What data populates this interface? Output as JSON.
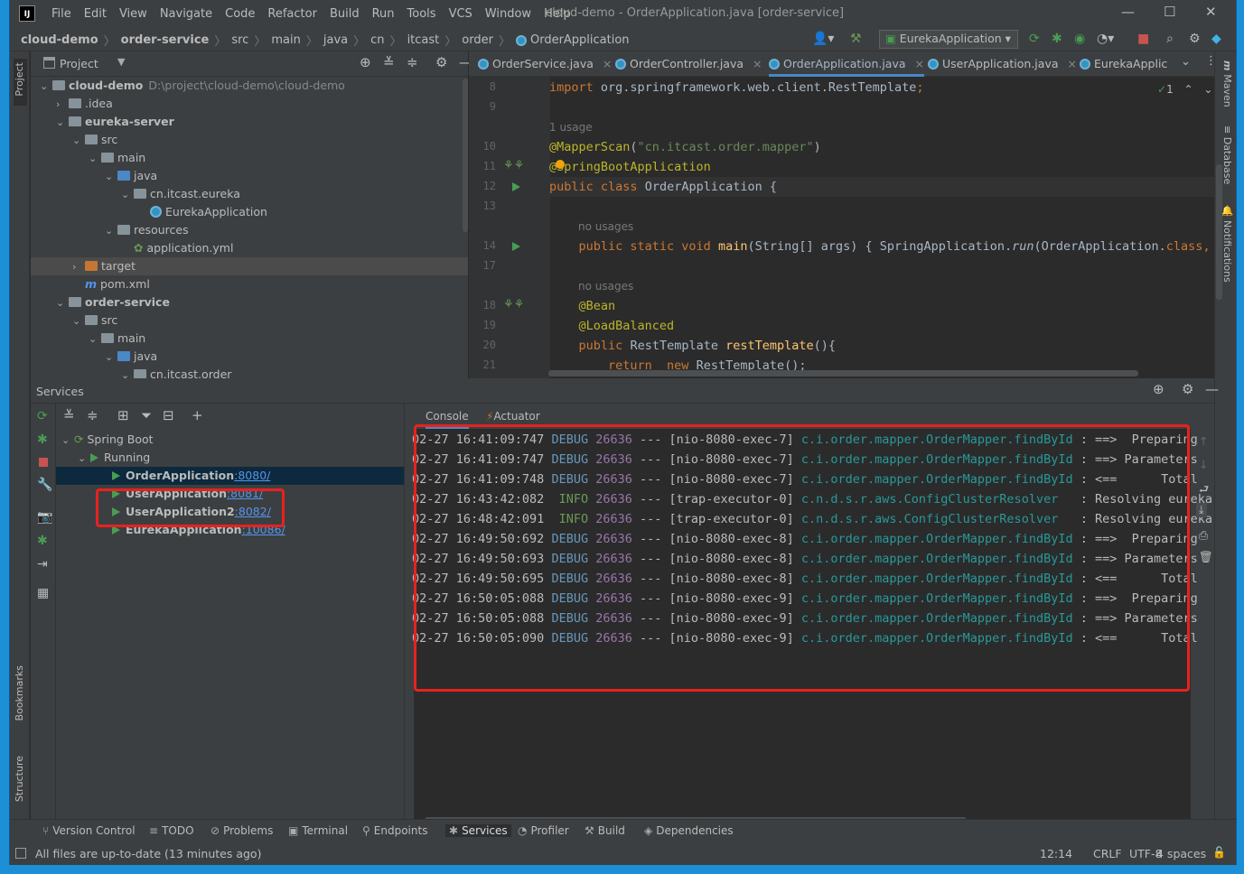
{
  "window": {
    "title": "cloud-demo - OrderApplication.java [order-service]",
    "logo": "IJ"
  },
  "menu": [
    "File",
    "Edit",
    "View",
    "Navigate",
    "Code",
    "Refactor",
    "Build",
    "Run",
    "Tools",
    "VCS",
    "Window",
    "Help"
  ],
  "breadcrumbs": [
    "cloud-demo",
    "order-service",
    "src",
    "main",
    "java",
    "cn",
    "itcast",
    "order",
    "OrderApplication"
  ],
  "run_config": "EurekaApplication",
  "project": {
    "title": "Project",
    "tree": [
      {
        "label": "cloud-demo",
        "path": "D:\\project\\cloud-demo\\cloud-demo",
        "depth": 0,
        "expanded": true,
        "kind": "module",
        "bold": true
      },
      {
        "label": ".idea",
        "depth": 1,
        "expanded": false,
        "kind": "folder"
      },
      {
        "label": "eureka-server",
        "depth": 1,
        "expanded": true,
        "kind": "module",
        "bold": true
      },
      {
        "label": "src",
        "depth": 2,
        "expanded": true,
        "kind": "folder"
      },
      {
        "label": "main",
        "depth": 3,
        "expanded": true,
        "kind": "folder"
      },
      {
        "label": "java",
        "depth": 4,
        "expanded": true,
        "kind": "blue"
      },
      {
        "label": "cn.itcast.eureka",
        "depth": 5,
        "expanded": true,
        "kind": "folder"
      },
      {
        "label": "EurekaApplication",
        "depth": 6,
        "kind": "class"
      },
      {
        "label": "resources",
        "depth": 4,
        "expanded": true,
        "kind": "folder"
      },
      {
        "label": "application.yml",
        "depth": 5,
        "kind": "yml"
      },
      {
        "label": "target",
        "depth": 2,
        "expanded": false,
        "kind": "orange",
        "selected": true
      },
      {
        "label": "pom.xml",
        "depth": 2,
        "kind": "pom"
      },
      {
        "label": "order-service",
        "depth": 1,
        "expanded": true,
        "kind": "module",
        "bold": true
      },
      {
        "label": "src",
        "depth": 2,
        "expanded": true,
        "kind": "folder"
      },
      {
        "label": "main",
        "depth": 3,
        "expanded": true,
        "kind": "folder"
      },
      {
        "label": "java",
        "depth": 4,
        "expanded": true,
        "kind": "blue"
      },
      {
        "label": "cn.itcast.order",
        "depth": 5,
        "expanded": true,
        "kind": "folder"
      }
    ]
  },
  "editor": {
    "tabs": [
      "OrderService.java",
      "OrderController.java",
      "OrderApplication.java",
      "UserApplication.java",
      "EurekaApplic"
    ],
    "active_tab": 2,
    "inspection": "1",
    "lines": [
      {
        "n": "8",
        "html": "<span style='color:#cc7832'>import</span> <span style='color:#a9b7c6'>org.springframework.web.client.RestTemplate</span><span style='color:#cc7832'>;</span>"
      },
      {
        "n": "9",
        "html": ""
      },
      {
        "n": "",
        "hint": "1 usage"
      },
      {
        "n": "10",
        "html": "<span style='color:#bbb529'>@MapperScan</span><span style='color:#a9b7c6'>(</span><span style='color:#6a8759'>\"cn.itcast.order.mapper\"</span><span style='color:#a9b7c6'>)</span>"
      },
      {
        "n": "11",
        "html": "<span style='color:#bbb529'>@SpringBootApplication</span>"
      },
      {
        "n": "12",
        "html": "<span style='color:#cc7832'>public class</span> <span style='color:#a9b7c6'>OrderApplication {</span>"
      },
      {
        "n": "13",
        "html": ""
      },
      {
        "n": "",
        "hint": "no usages"
      },
      {
        "n": "14",
        "html": "    <span style='color:#cc7832'>public static void</span> <span style='color:#ffc66d'>main</span><span style='color:#a9b7c6'>(String[] args) { SpringApplication.</span><span style='color:#a9b7c6;font-style:italic'>run</span><span style='color:#a9b7c6'>(OrderApplication.</span><span style='color:#cc7832'>class</span><span style='color:#cc7832'>, </span><span style='color:#a9b7c6'>args)</span>"
      },
      {
        "n": "17",
        "html": ""
      },
      {
        "n": "",
        "hint": "no usages"
      },
      {
        "n": "18",
        "html": "    <span style='color:#bbb529'>@Bean</span>"
      },
      {
        "n": "19",
        "html": "    <span style='color:#bbb529'>@LoadBalanced</span>"
      },
      {
        "n": "20",
        "html": "    <span style='color:#cc7832'>public</span> <span style='color:#a9b7c6'>RestTemplate</span> <span style='color:#ffc66d'>restTemplate</span><span style='color:#a9b7c6'>(){</span>"
      },
      {
        "n": "21",
        "html": "        <span style='color:#cc7832'>return  new</span> <span style='color:#a9b7c6'>RestTemplate();</span>"
      }
    ]
  },
  "services": {
    "title": "Services",
    "tree": [
      {
        "label": "Spring Boot",
        "depth": 0,
        "kind": "group"
      },
      {
        "label": "Running",
        "depth": 1,
        "kind": "running"
      },
      {
        "label": "OrderApplication",
        "port": ":8080/",
        "depth": 2,
        "selected": true
      },
      {
        "label": "UserApplication",
        "port": ":8081/",
        "depth": 2
      },
      {
        "label": "UserApplication2",
        "port": ":8082/",
        "depth": 2
      },
      {
        "label": "EurekaApplication",
        "port": ":10086/",
        "depth": 2
      }
    ],
    "console_tabs": [
      "Console",
      "Actuator"
    ],
    "log": [
      {
        "ts": "02-27 16:41:09:747",
        "lvl": "DEBUG",
        "pid": "26636",
        "sep": "---",
        "thread": "[nio-8080-exec-7]",
        "logger": "c.i.order.mapper.OrderMapper.findById",
        "msg": ": ==>  Preparing"
      },
      {
        "ts": "02-27 16:41:09:747",
        "lvl": "DEBUG",
        "pid": "26636",
        "sep": "---",
        "thread": "[nio-8080-exec-7]",
        "logger": "c.i.order.mapper.OrderMapper.findById",
        "msg": ": ==> Parameters"
      },
      {
        "ts": "02-27 16:41:09:748",
        "lvl": "DEBUG",
        "pid": "26636",
        "sep": "---",
        "thread": "[nio-8080-exec-7]",
        "logger": "c.i.order.mapper.OrderMapper.findById",
        "msg": ": <==      Total"
      },
      {
        "ts": "02-27 16:43:42:082",
        "lvl": " INFO",
        "pid": "26636",
        "sep": "---",
        "thread": "[trap-executor-0]",
        "logger": "c.n.d.s.r.aws.ConfigClusterResolver  ",
        "msg": ": Resolving eureka"
      },
      {
        "ts": "02-27 16:48:42:091",
        "lvl": " INFO",
        "pid": "26636",
        "sep": "---",
        "thread": "[trap-executor-0]",
        "logger": "c.n.d.s.r.aws.ConfigClusterResolver  ",
        "msg": ": Resolving eureka"
      },
      {
        "ts": "02-27 16:49:50:692",
        "lvl": "DEBUG",
        "pid": "26636",
        "sep": "---",
        "thread": "[nio-8080-exec-8]",
        "logger": "c.i.order.mapper.OrderMapper.findById",
        "msg": ": ==>  Preparing"
      },
      {
        "ts": "02-27 16:49:50:693",
        "lvl": "DEBUG",
        "pid": "26636",
        "sep": "---",
        "thread": "[nio-8080-exec-8]",
        "logger": "c.i.order.mapper.OrderMapper.findById",
        "msg": ": ==> Parameters"
      },
      {
        "ts": "02-27 16:49:50:695",
        "lvl": "DEBUG",
        "pid": "26636",
        "sep": "---",
        "thread": "[nio-8080-exec-8]",
        "logger": "c.i.order.mapper.OrderMapper.findById",
        "msg": ": <==      Total"
      },
      {
        "ts": "02-27 16:50:05:088",
        "lvl": "DEBUG",
        "pid": "26636",
        "sep": "---",
        "thread": "[nio-8080-exec-9]",
        "logger": "c.i.order.mapper.OrderMapper.findById",
        "msg": ": ==>  Preparing"
      },
      {
        "ts": "02-27 16:50:05:088",
        "lvl": "DEBUG",
        "pid": "26636",
        "sep": "---",
        "thread": "[nio-8080-exec-9]",
        "logger": "c.i.order.mapper.OrderMapper.findById",
        "msg": ": ==> Parameters"
      },
      {
        "ts": "02-27 16:50:05:090",
        "lvl": "DEBUG",
        "pid": "26636",
        "sep": "---",
        "thread": "[nio-8080-exec-9]",
        "logger": "c.i.order.mapper.OrderMapper.findById",
        "msg": ": <==      Total"
      }
    ]
  },
  "bottom_tabs": [
    "Version Control",
    "TODO",
    "Problems",
    "Terminal",
    "Endpoints",
    "Services",
    "Profiler",
    "Build",
    "Dependencies"
  ],
  "status": {
    "message": "All files are up-to-date (13 minutes ago)",
    "position": "12:14",
    "line_sep": "CRLF",
    "encoding": "UTF-8",
    "indent": "4 spaces"
  },
  "side_left": [
    "Project",
    "Bookmarks",
    "Structure"
  ],
  "side_right": [
    "Maven",
    "Database",
    "Notifications"
  ]
}
